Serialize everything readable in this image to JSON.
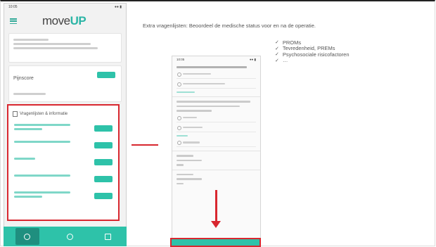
{
  "left_phone": {
    "status_time": "10:05",
    "status_icons": "●● ▮",
    "logo_prefix": "move",
    "logo_suffix": "UP",
    "profile_title": "Pijnscore",
    "menu_title": "Vragenlijsten & informatie"
  },
  "headline": "Extra vragenlijsten: Beoordeel de medische status voor en na de operatie.",
  "checklist": [
    {
      "icon": "✓",
      "label": "PROMs"
    },
    {
      "icon": "✓",
      "label": "Tevredenheid, PREMs"
    },
    {
      "icon": "✓",
      "label": "Psychosociale risicofactoren"
    },
    {
      "icon": "✓",
      "label": "…"
    }
  ],
  "right_phone": {
    "status_time": "10:05",
    "status_icons": "●● ▮"
  },
  "colors": {
    "accent": "#2ec2a9",
    "highlight": "#d8272f",
    "text": "#555555"
  }
}
